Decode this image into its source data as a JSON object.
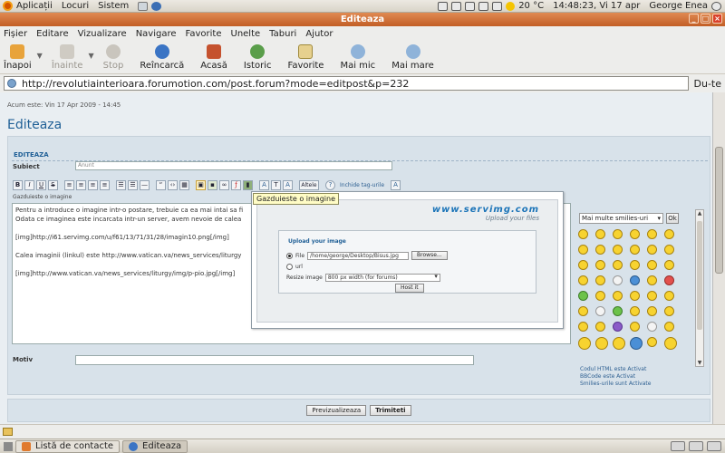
{
  "top_panel": {
    "menus": [
      "Aplicații",
      "Locuri",
      "Sistem"
    ],
    "temperature": "20 °C",
    "datetime": "14:48:23, Vi 17 apr",
    "user": "George Enea"
  },
  "window": {
    "title": "Editeaza"
  },
  "menu_bar": [
    "Fișier",
    "Editare",
    "Vizualizare",
    "Navigare",
    "Favorite",
    "Unelte",
    "Taburi",
    "Ajutor"
  ],
  "toolbar": {
    "back": "Înapoi",
    "forward": "Înainte",
    "stop": "Stop",
    "reload": "Reîncarcă",
    "home": "Acasă",
    "history": "Istoric",
    "bookmarks": "Favorite",
    "zoom_out": "Mai mic",
    "zoom_in": "Mai mare"
  },
  "urlbar": {
    "url": "http://revolutiainterioara.forumotion.com/post.forum?mode=editpost&p=232",
    "go": "Du-te"
  },
  "page": {
    "acum": "Acum este: Vin 17 Apr 2009 - 14:45",
    "heading": "Editeaza",
    "panel_heading": "EDITEAZA",
    "subject_label": "Subiect",
    "subject_value": "Anunt",
    "other_label": "Altele",
    "close_tags": "Inchide tag-urile",
    "tooltip": "Gazduieste o imagine",
    "editor_label": "Gazduieste o imagine",
    "textarea_lines": [
      "Pentru a introduce o imagine intr-o postare, trebuie ca ea mai intai sa fi",
      "Odata ce imaginea este incarcata intr-un server, avem nevoie de calea",
      "",
      "[img]http://i61.servimg.com/u/f61/13/71/31/28/imagin10.png[/img]",
      "",
      "Calea imaginii (linkul) este http://www.vatican.va/news_services/liturgy",
      "",
      "[img]http://www.vatican.va/news_services/liturgy/img/p-pio.jpg[/img]"
    ],
    "motiv_label": "Motiv",
    "preview_button": "Previzualizeaza",
    "submit_button": "Trimiteti"
  },
  "upload_popup": {
    "logo": "www.servimg.com",
    "tagline": "Upload your files",
    "title": "Upload your image",
    "file_label": "File",
    "file_value": "/home/george/Desktop/Bisus.jpg",
    "browse": "Browse...",
    "url_label": "url",
    "resize_label": "Resize image",
    "resize_value": "800 px width (for forums)",
    "host_button": "Host it"
  },
  "smilies": {
    "select_value": "Mai multe smilies-uri",
    "ok": "Ok",
    "footer": [
      "Codul HTML este Activat",
      "BBCode este Activat",
      "Smilies-urile sunt Activate"
    ]
  },
  "taskbar": {
    "tasks": [
      "Listă de contacte",
      "Editeaza"
    ]
  }
}
